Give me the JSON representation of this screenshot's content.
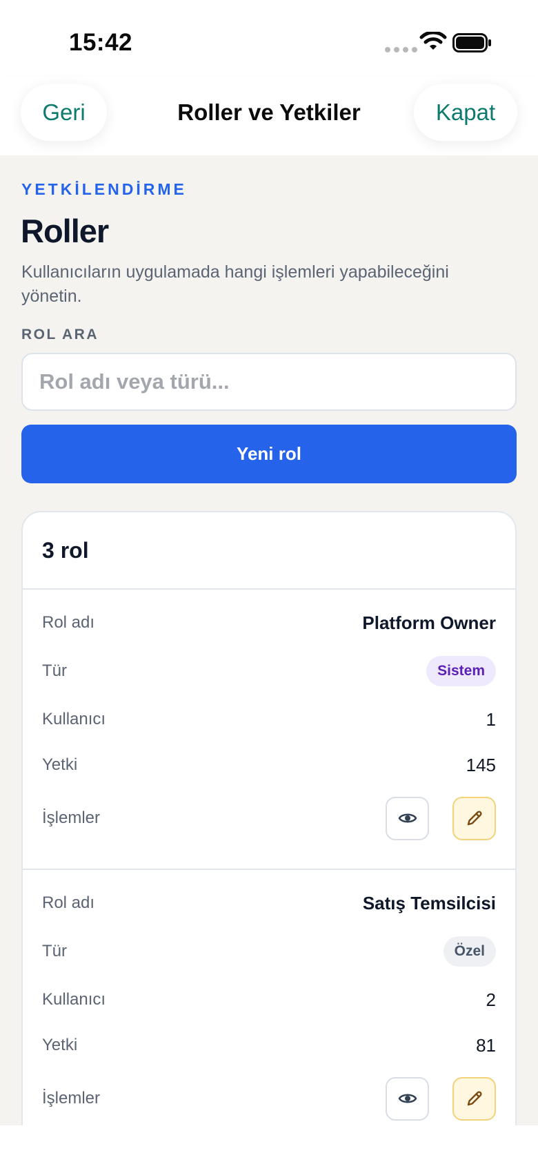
{
  "status_bar": {
    "time": "15:42"
  },
  "nav": {
    "back_label": "Geri",
    "title": "Roller ve Yetkiler",
    "close_label": "Kapat"
  },
  "header": {
    "eyebrow": "YETKİLENDİRME",
    "title": "Roller",
    "subtitle": "Kullanıcıların uygulamada hangi işlemleri yapabileceğini yönetin."
  },
  "search": {
    "label": "ROL ARA",
    "placeholder": "Rol adı veya türü...",
    "value": ""
  },
  "new_role_label": "Yeni rol",
  "list": {
    "count_label": "3 rol",
    "field_labels": {
      "name": "Rol adı",
      "type": "Tür",
      "users": "Kullanıcı",
      "permissions": "Yetki",
      "actions": "İşlemler"
    },
    "roles": [
      {
        "name": "Platform Owner",
        "type": "Sistem",
        "users": "1",
        "permissions": "145"
      },
      {
        "name": "Satış Temsilcisi",
        "type": "Özel",
        "users": "2",
        "permissions": "81"
      }
    ]
  },
  "colors": {
    "accent": "#2563eb",
    "nav_action": "#0e7a6e",
    "background": "#f4f3f0",
    "system_badge_bg": "#efe9fd",
    "system_badge_text": "#5b21b6",
    "edit_button_bg": "#fff7df",
    "edit_button_border": "#f2d27a"
  },
  "icons": {
    "view": "eye-icon",
    "edit": "pencil-icon",
    "wifi": "wifi-icon",
    "battery": "battery-icon",
    "signal": "signal-icon"
  }
}
